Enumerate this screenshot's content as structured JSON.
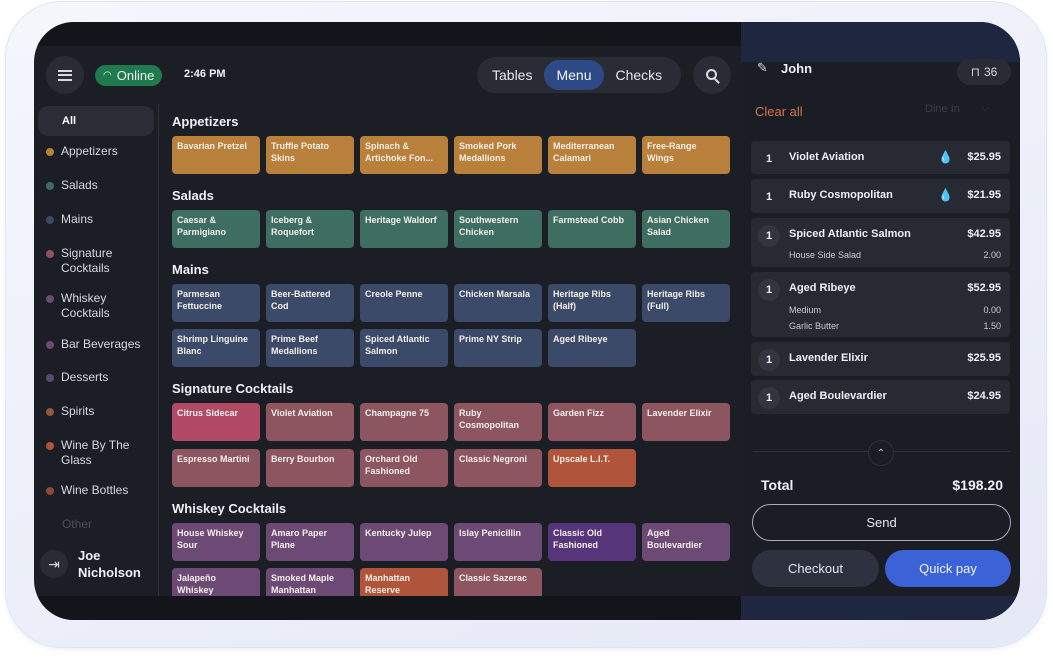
{
  "header": {
    "status": "Online",
    "time": "2:46 PM",
    "tabs": [
      {
        "label": "Tables",
        "active": false
      },
      {
        "label": "Menu",
        "active": true
      },
      {
        "label": "Checks",
        "active": false
      }
    ]
  },
  "sidebar": {
    "items": [
      {
        "label": "All",
        "color": null
      },
      {
        "label": "Appetizers",
        "color": "#b8803a"
      },
      {
        "label": "Salads",
        "color": "#3e6d61"
      },
      {
        "label": "Mains",
        "color": "#3a4a68"
      },
      {
        "label": "Signature Cocktails",
        "color": "#8c5560"
      },
      {
        "label": "Whiskey Cocktails",
        "color": "#6c4a75"
      },
      {
        "label": "Bar Beverages",
        "color": "#6c4a75"
      },
      {
        "label": "Desserts",
        "color": "#5a4a6e"
      },
      {
        "label": "Spirits",
        "color": "#8c5a3a"
      },
      {
        "label": "Wine By The Glass",
        "color": "#b0543c"
      },
      {
        "label": "Wine Bottles",
        "color": "#8c4a3a"
      },
      {
        "label": "Other",
        "color": null
      }
    ],
    "user": "Joe Nicholson"
  },
  "menu": {
    "sections": [
      {
        "title": "Appetizers",
        "items": [
          "Bavarian Pretzel",
          "Truffle Potato Skins",
          "Spinach & Artichoke Fon...",
          "Smoked Pork Medallions",
          "Mediterranean Calamari",
          "Free-Range Wings"
        ]
      },
      {
        "title": "Salads",
        "items": [
          "Caesar & Parmigiano",
          "Iceberg & Roquefort",
          "Heritage Waldorf",
          "Southwestern Chicken",
          "Farmstead Cobb",
          "Asian Chicken Salad"
        ]
      },
      {
        "title": "Mains",
        "items": [
          "Parmesan Fettuccine",
          "Beer-Battered Cod",
          "Creole Penne",
          "Chicken Marsala",
          "Heritage Ribs (Half)",
          "Heritage Ribs (Full)",
          "Shrimp Linguine Blanc",
          "Prime Beef Medallions",
          "Spiced Atlantic Salmon",
          "Prime NY Strip",
          "Aged Ribeye"
        ]
      },
      {
        "title": "Signature Cocktails",
        "items": [
          "Citrus Sidecar",
          "Violet Aviation",
          "Champagne 75",
          "Ruby Cosmopolitan",
          "Garden Fizz",
          "Lavender Elixir",
          "Espresso Martini",
          "Berry Bourbon",
          "Orchard Old Fashioned",
          "Classic Negroni",
          "Upscale L.I.T."
        ]
      },
      {
        "title": "Whiskey Cocktails",
        "items": [
          "House Whiskey Sour",
          "Amaro Paper Plane",
          "Kentucky Julep",
          "Islay Penicillin",
          "Classic Old Fashioned",
          "Aged Boulevardier",
          "Jalapeño Whiskey",
          "Smoked Maple Manhattan",
          "Manhattan Reserve",
          "Classic Sazerac"
        ]
      }
    ]
  },
  "order": {
    "guest": "John",
    "table": "36",
    "clear_all": "Clear all",
    "dine_mode": "Dine In",
    "items": [
      {
        "qty": "1",
        "name": "Violet Aviation",
        "price": "$25.95",
        "fire": true,
        "mods": []
      },
      {
        "qty": "1",
        "name": "Ruby Cosmopolitan",
        "price": "$21.95",
        "fire": true,
        "mods": []
      },
      {
        "qty": "1",
        "name": "Spiced Atlantic Salmon",
        "price": "$42.95",
        "fire": false,
        "mods": [
          {
            "name": "House Side Salad",
            "price": "2.00"
          }
        ]
      },
      {
        "qty": "1",
        "name": "Aged Ribeye",
        "price": "$52.95",
        "fire": false,
        "mods": [
          {
            "name": "Medium",
            "price": "0.00"
          },
          {
            "name": "Garlic Butter",
            "price": "1.50"
          }
        ]
      },
      {
        "qty": "1",
        "name": "Lavender Elixir",
        "price": "$25.95",
        "fire": false,
        "mods": []
      },
      {
        "qty": "1",
        "name": "Aged Boulevardier",
        "price": "$24.95",
        "fire": false,
        "mods": []
      }
    ],
    "total_label": "Total",
    "total": "$198.20",
    "send_label": "Send",
    "checkout_label": "Checkout",
    "quickpay_label": "Quick pay"
  }
}
